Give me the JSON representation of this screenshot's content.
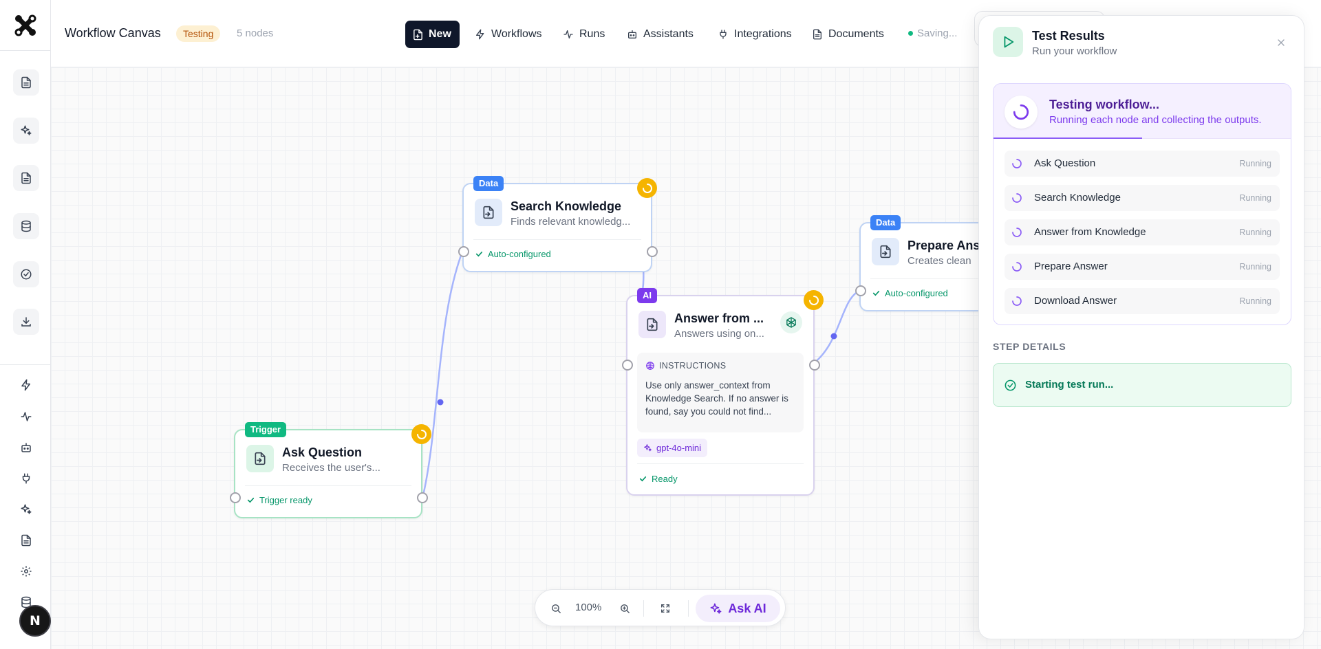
{
  "app": {
    "title": "Workflow Canvas",
    "status_badge": "Testing",
    "node_count": "5 nodes",
    "saving_text": "Saving..."
  },
  "nav": {
    "new_label": "New",
    "items": [
      {
        "label": "Workflows",
        "icon": "bolt-icon"
      },
      {
        "label": "Runs",
        "icon": "activity-icon"
      },
      {
        "label": "Assistants",
        "icon": "bot-icon"
      },
      {
        "label": "Integrations",
        "icon": "plug-icon"
      },
      {
        "label": "Documents",
        "icon": "document-icon"
      }
    ]
  },
  "sidebar": {
    "avatar_initial": "N",
    "top_icons": [
      "document-icon",
      "sparkles-icon",
      "document-icon",
      "database-icon",
      "check-circle-icon",
      "download-icon"
    ],
    "bottom_icons": [
      "bolt-icon",
      "activity-icon",
      "bot-icon",
      "plug-icon",
      "sparkles-icon",
      "document-icon",
      "gear-icon",
      "database-icon"
    ]
  },
  "nodes": {
    "ask_question": {
      "tag": "Trigger",
      "title": "Ask Question",
      "description": "Receives the user's...",
      "footer": "Trigger ready"
    },
    "search_knowledge": {
      "tag": "Data",
      "title": "Search Knowledge",
      "description": "Finds relevant knowledg...",
      "footer": "Auto-configured"
    },
    "answer_from_knowledge": {
      "tag": "AI",
      "title": "Answer from ...",
      "description": "Answers using on...",
      "instructions_label": "INSTRUCTIONS",
      "instructions_text": "Use only answer_context from Knowledge Search. If no answer is found, say you could not find...",
      "model": "gpt-4o-mini",
      "footer": "Ready"
    },
    "prepare_answer": {
      "tag": "Data",
      "title": "Prepare Ans",
      "description": "Creates clean",
      "footer": "Auto-configured"
    }
  },
  "toolbar": {
    "zoom": "100%",
    "ask_ai": "Ask AI"
  },
  "panel": {
    "title": "Test Results",
    "subtitle": "Run your workflow",
    "run_title": "Testing workflow...",
    "run_subtitle": "Running each node and collecting the outputs.",
    "progress": 0.5,
    "steps": [
      {
        "name": "Ask Question",
        "status": "Running"
      },
      {
        "name": "Search Knowledge",
        "status": "Running"
      },
      {
        "name": "Answer from Knowledge",
        "status": "Running"
      },
      {
        "name": "Prepare Answer",
        "status": "Running"
      },
      {
        "name": "Download Answer",
        "status": "Running"
      }
    ],
    "details_label": "STEP DETAILS",
    "details_text": "Starting test run..."
  },
  "colors": {
    "trigger": "#10b981",
    "data": "#3b82f6",
    "ai": "#7c3aed",
    "running_badge": "#f5b400",
    "edge": "#a5b4fc"
  }
}
